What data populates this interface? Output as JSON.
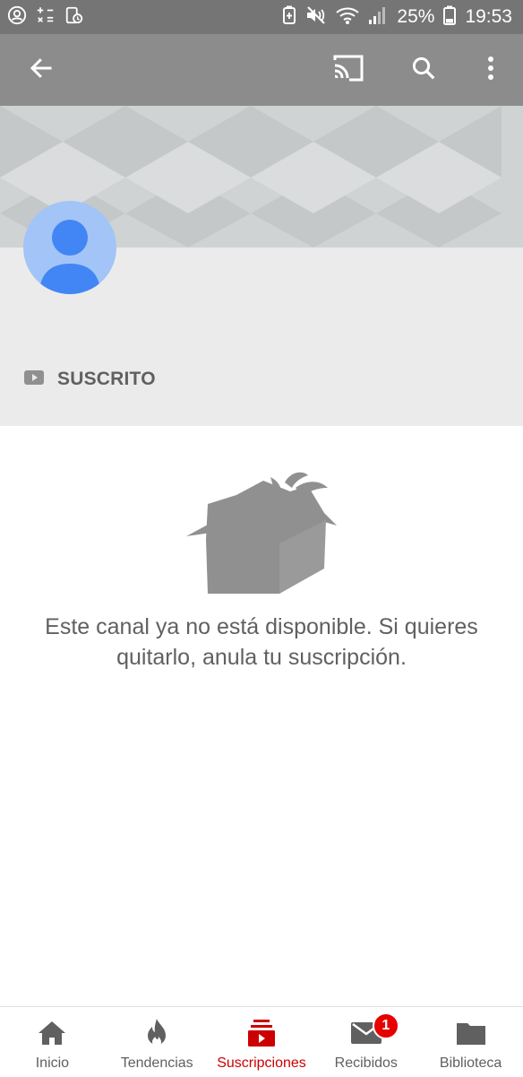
{
  "status_bar": {
    "battery_percent": "25%",
    "time": "19:53"
  },
  "app_bar": {
    "back_icon": "arrow-left-icon",
    "cast_icon": "cast-icon",
    "search_icon": "search-icon",
    "more_icon": "more-vert-icon"
  },
  "channel": {
    "subscribed_label": "SUSCRITO",
    "unavailable_message": "Este canal ya no está disponible. Si quieres quitarlo, anula tu suscripción."
  },
  "bottom_nav": {
    "items": [
      {
        "label": "Inicio",
        "icon": "home-icon"
      },
      {
        "label": "Tendencias",
        "icon": "flame-icon"
      },
      {
        "label": "Suscripciones",
        "icon": "subscriptions-icon",
        "active": true
      },
      {
        "label": "Recibidos",
        "icon": "mail-icon",
        "badge": "1"
      },
      {
        "label": "Biblioteca",
        "icon": "folder-icon"
      }
    ]
  },
  "colors": {
    "accent": "#cc0000",
    "appbar": "#8c8c8c",
    "statusbar": "#757575",
    "avatar_bg": "#a3c4f7",
    "avatar_fg": "#4285f4"
  }
}
